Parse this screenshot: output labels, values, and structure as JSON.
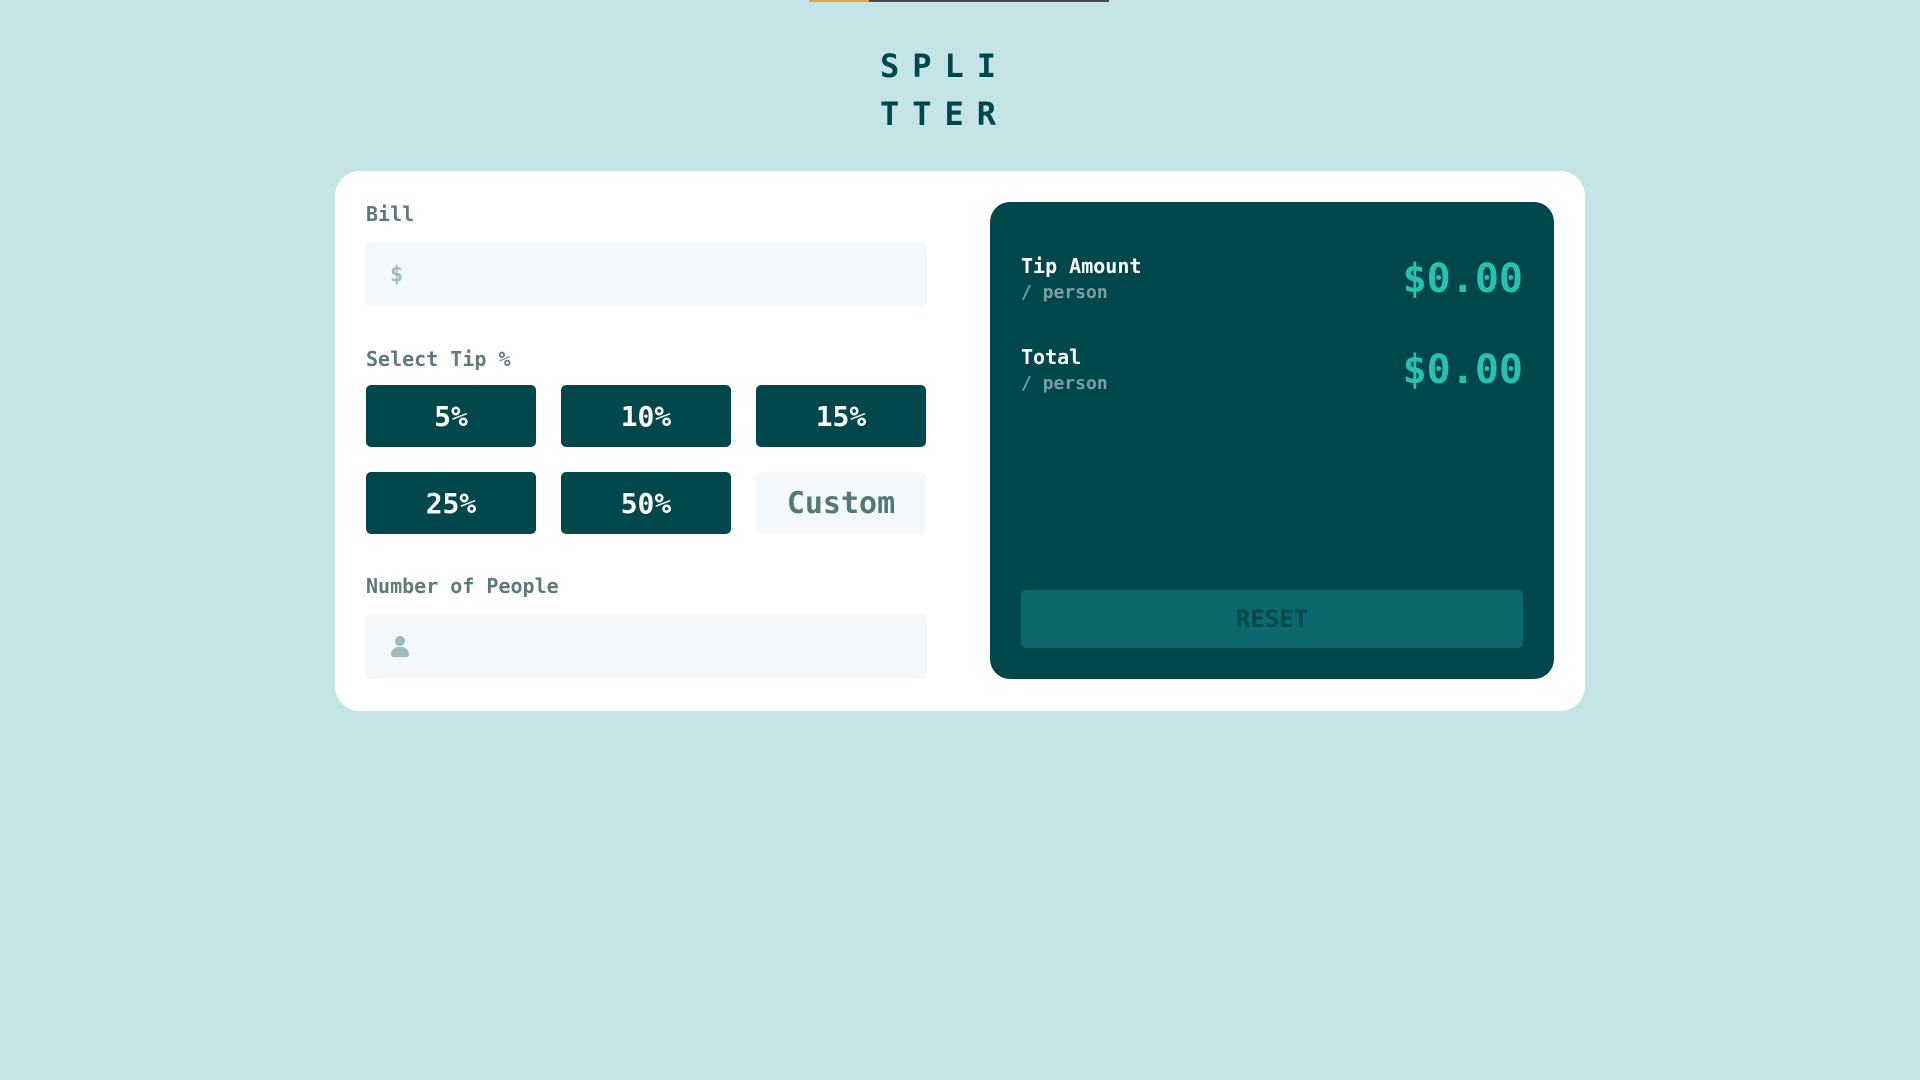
{
  "logo": {
    "line1": "SPLI",
    "line2": "TTER"
  },
  "bill": {
    "label": "Bill",
    "currency_symbol": "$",
    "value": ""
  },
  "tip": {
    "label": "Select Tip %",
    "options": [
      "5%",
      "10%",
      "15%",
      "25%",
      "50%"
    ],
    "custom_label": "Custom"
  },
  "people": {
    "label": "Number of People",
    "value": ""
  },
  "results": {
    "tip_amount": {
      "title": "Tip Amount",
      "sub": "/ person",
      "value": "$0.00"
    },
    "total": {
      "title": "Total",
      "sub": "/ person",
      "value": "$0.00"
    },
    "reset_label": "RESET"
  },
  "colors": {
    "background": "#c5e4e7",
    "dark_cyan": "#00474b",
    "accent": "#26c2ae",
    "input_bg": "#f3f9fa",
    "top_accent": "#e8a04a"
  }
}
